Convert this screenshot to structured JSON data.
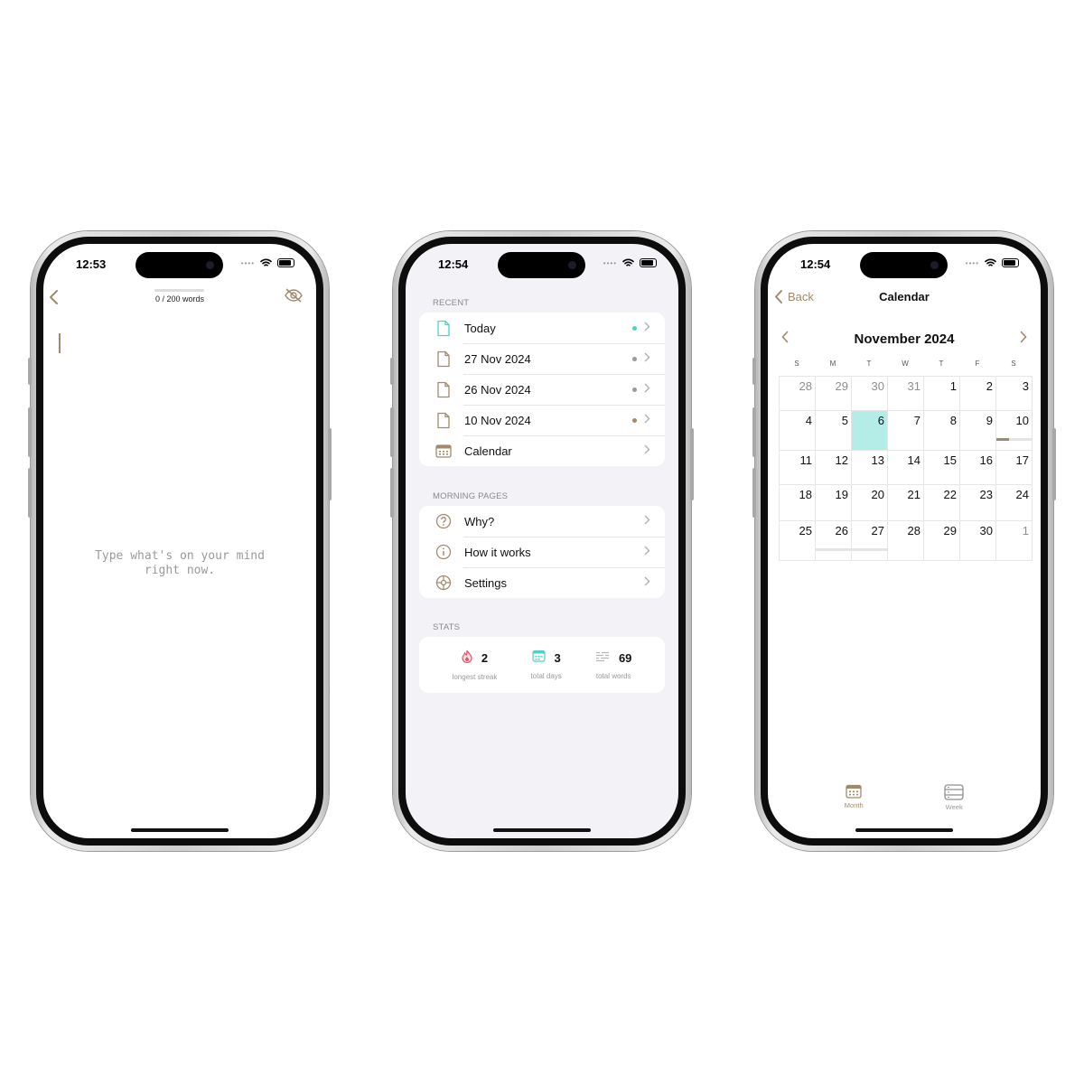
{
  "colors": {
    "accent": "#a08a6b",
    "today_teal": "#4fd1c5",
    "selected_day": "#b4ece8",
    "streak_red": "#e8546a"
  },
  "phone1": {
    "status_time": "12:53",
    "word_count": "0 / 200 words",
    "placeholder": "Type what's on your mind right now.",
    "icons": {
      "back": "chevron-left-icon",
      "hide": "eye-slash-icon"
    }
  },
  "phone2": {
    "status_time": "12:54",
    "recent_header": "RECENT",
    "recent": [
      {
        "label": "Today",
        "dot": "#4fd1c5",
        "icon": "document-icon"
      },
      {
        "label": "27 Nov 2024",
        "dot": "#9a9a9a",
        "icon": "document-icon"
      },
      {
        "label": "26 Nov 2024",
        "dot": "#9a9a9a",
        "icon": "document-icon"
      },
      {
        "label": "10 Nov 2024",
        "dot": "#a08a6b",
        "icon": "document-icon"
      },
      {
        "label": "Calendar",
        "icon": "calendar-icon"
      }
    ],
    "morning_header": "MORNING PAGES",
    "morning": [
      {
        "label": "Why?",
        "icon": "question-circle-icon"
      },
      {
        "label": "How it works",
        "icon": "info-circle-icon"
      },
      {
        "label": "Settings",
        "icon": "gear-icon"
      }
    ],
    "stats_header": "STATS",
    "stats": [
      {
        "value": "2",
        "label": "longest streak",
        "icon": "flame-icon"
      },
      {
        "value": "3",
        "label": "total days",
        "icon": "calendar-icon"
      },
      {
        "value": "69",
        "label": "total words",
        "icon": "text-lines-icon"
      }
    ]
  },
  "phone3": {
    "status_time": "12:54",
    "back_label": "Back",
    "title": "Calendar",
    "month": "November 2024",
    "weekdays": [
      "S",
      "M",
      "T",
      "W",
      "T",
      "F",
      "S"
    ],
    "weeks": [
      [
        "28",
        "29",
        "30",
        "31",
        "1",
        "2",
        "3"
      ],
      [
        "4",
        "5",
        "6",
        "7",
        "8",
        "9",
        "10"
      ],
      [
        "11",
        "12",
        "13",
        "14",
        "15",
        "16",
        "17"
      ],
      [
        "18",
        "19",
        "20",
        "21",
        "22",
        "23",
        "24"
      ],
      [
        "25",
        "26",
        "27",
        "28",
        "29",
        "30",
        "1"
      ]
    ],
    "selected_day": "6",
    "tabs": [
      {
        "label": "Month",
        "icon": "calendar-month-icon",
        "active": true
      },
      {
        "label": "Week",
        "icon": "week-list-icon",
        "active": false
      }
    ]
  }
}
